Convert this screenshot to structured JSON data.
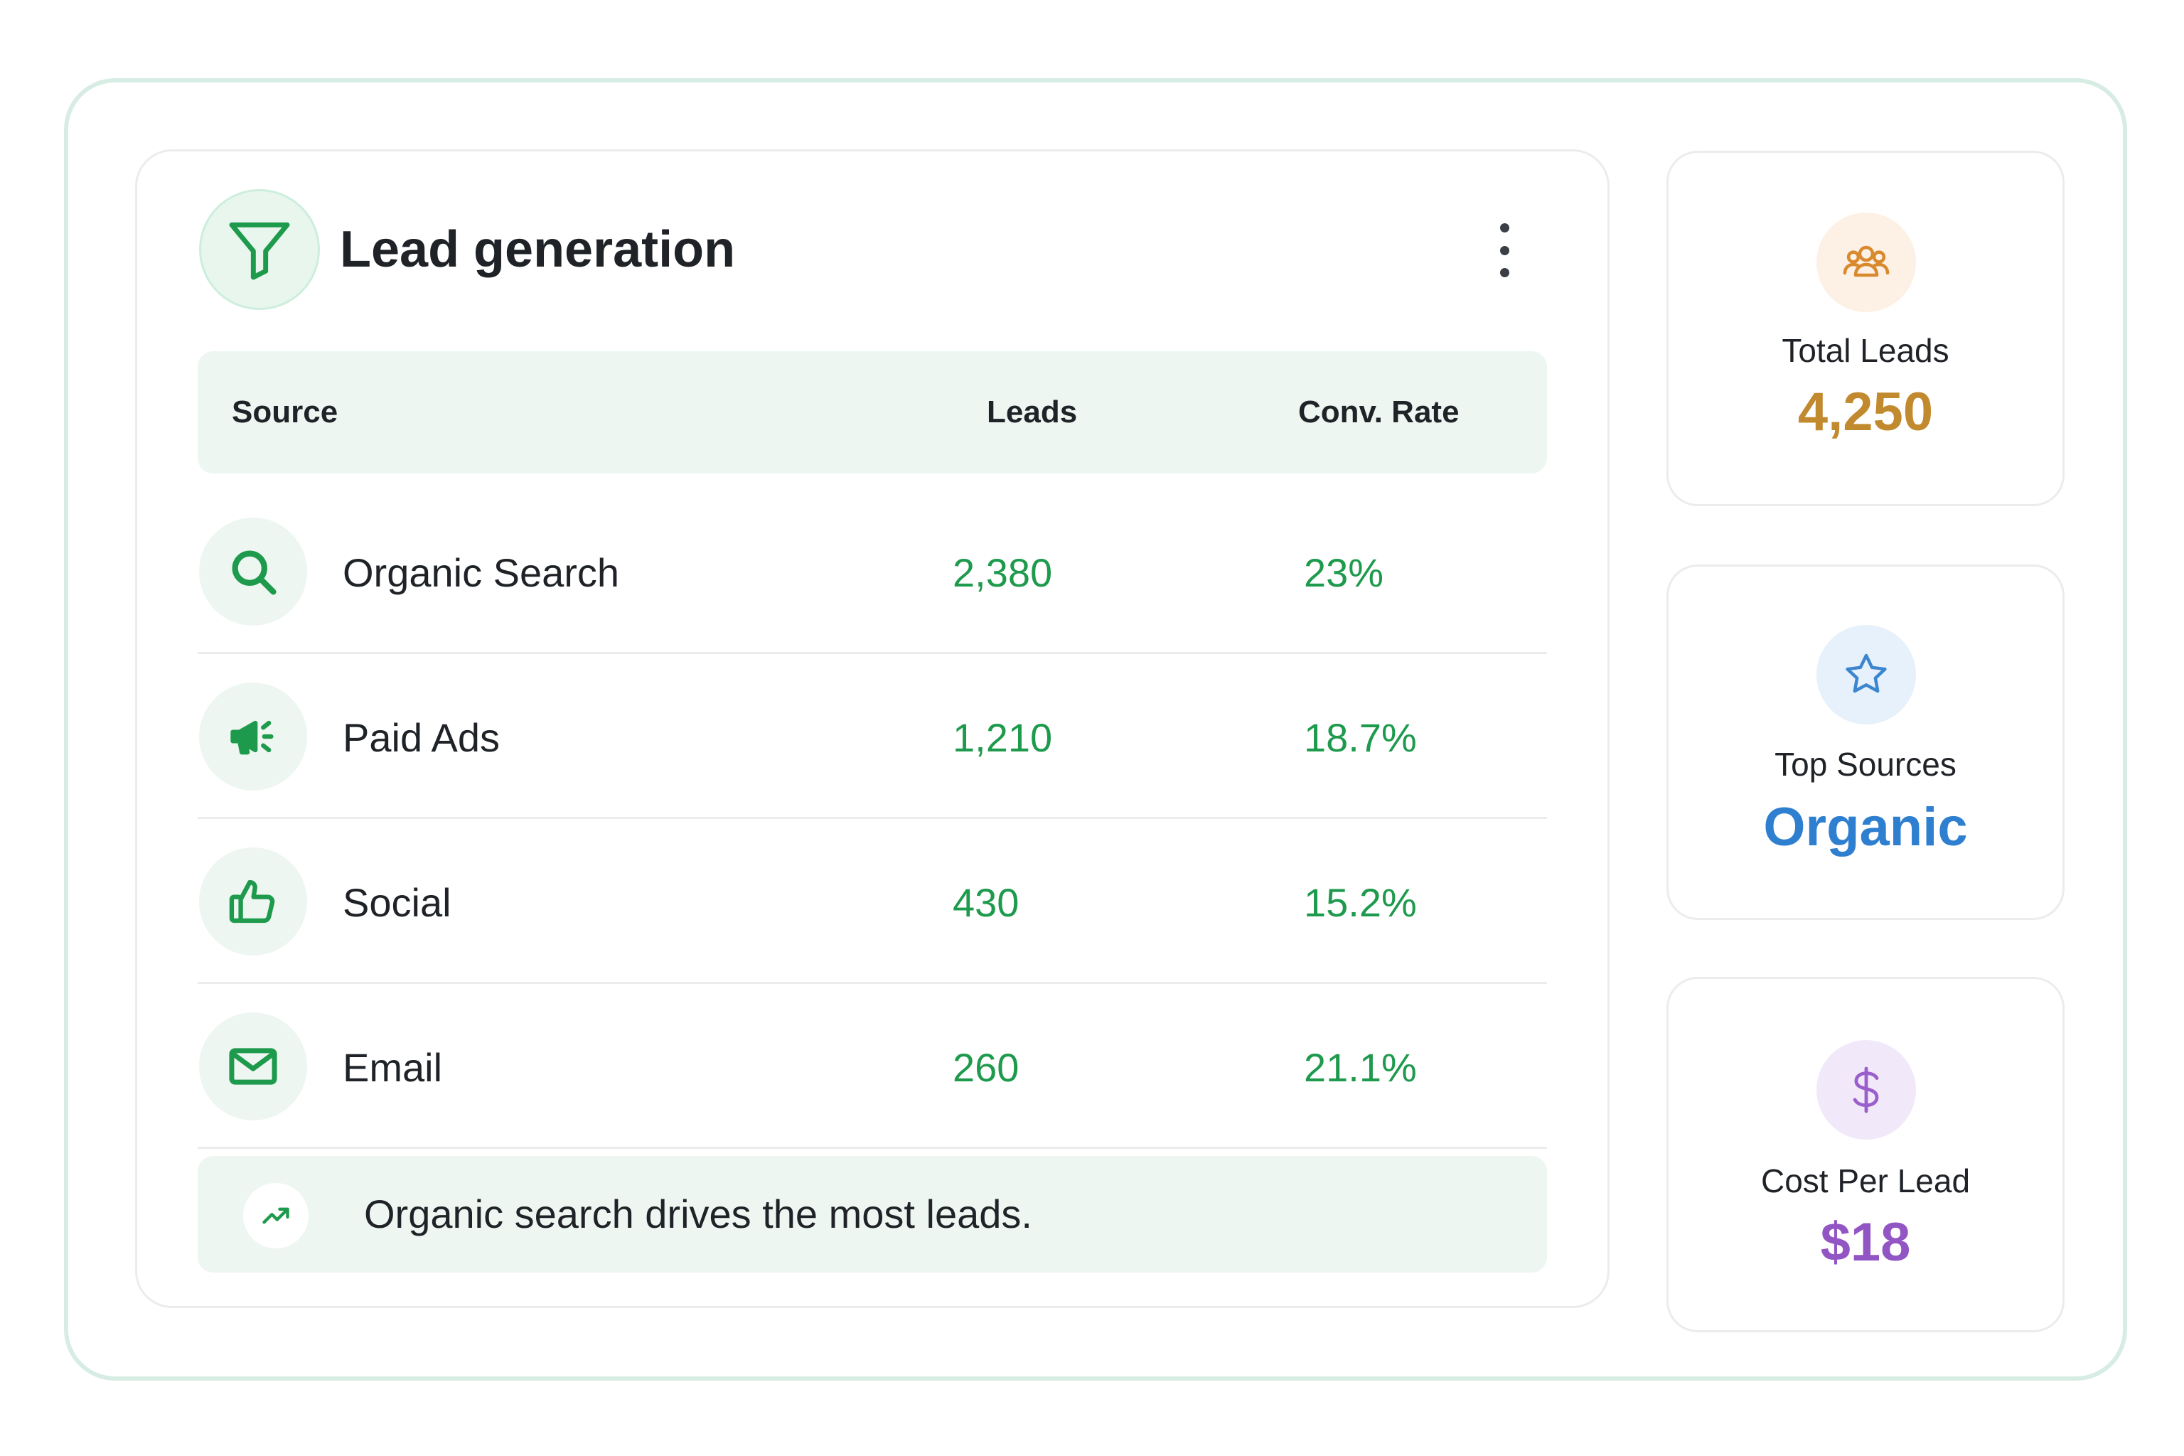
{
  "header": {
    "title": "Lead generation"
  },
  "table": {
    "columns": [
      "Source",
      "Leads",
      "Conv. Rate"
    ],
    "rows": [
      {
        "icon": "search-icon",
        "source": "Organic Search",
        "leads": "2,380",
        "conv_rate": "23%"
      },
      {
        "icon": "megaphone-icon",
        "source": "Paid Ads",
        "leads": "1,210",
        "conv_rate": "18.7%"
      },
      {
        "icon": "thumbs-up-icon",
        "source": "Social",
        "leads": "430",
        "conv_rate": "15.2%"
      },
      {
        "icon": "mail-icon",
        "source": "Email",
        "leads": "260",
        "conv_rate": "21.1%"
      }
    ]
  },
  "insight": {
    "icon": "trending-up-icon",
    "text": "Organic search drives the most leads."
  },
  "stats": [
    {
      "icon": "users-icon",
      "label": "Total Leads",
      "value": "4,250",
      "color": "#c28a2e",
      "icon_bg": "#fdf0e4"
    },
    {
      "icon": "star-icon",
      "label": "Top Sources",
      "value": "Organic",
      "color": "#2f7fd1",
      "icon_bg": "#e6f1fb"
    },
    {
      "icon": "dollar-icon",
      "label": "Cost Per Lead",
      "value": "$18",
      "color": "#9256c4",
      "icon_bg": "#f1e8f9"
    }
  ],
  "colors": {
    "accent_green": "#1e9a4d",
    "border": "#d7ede3"
  }
}
